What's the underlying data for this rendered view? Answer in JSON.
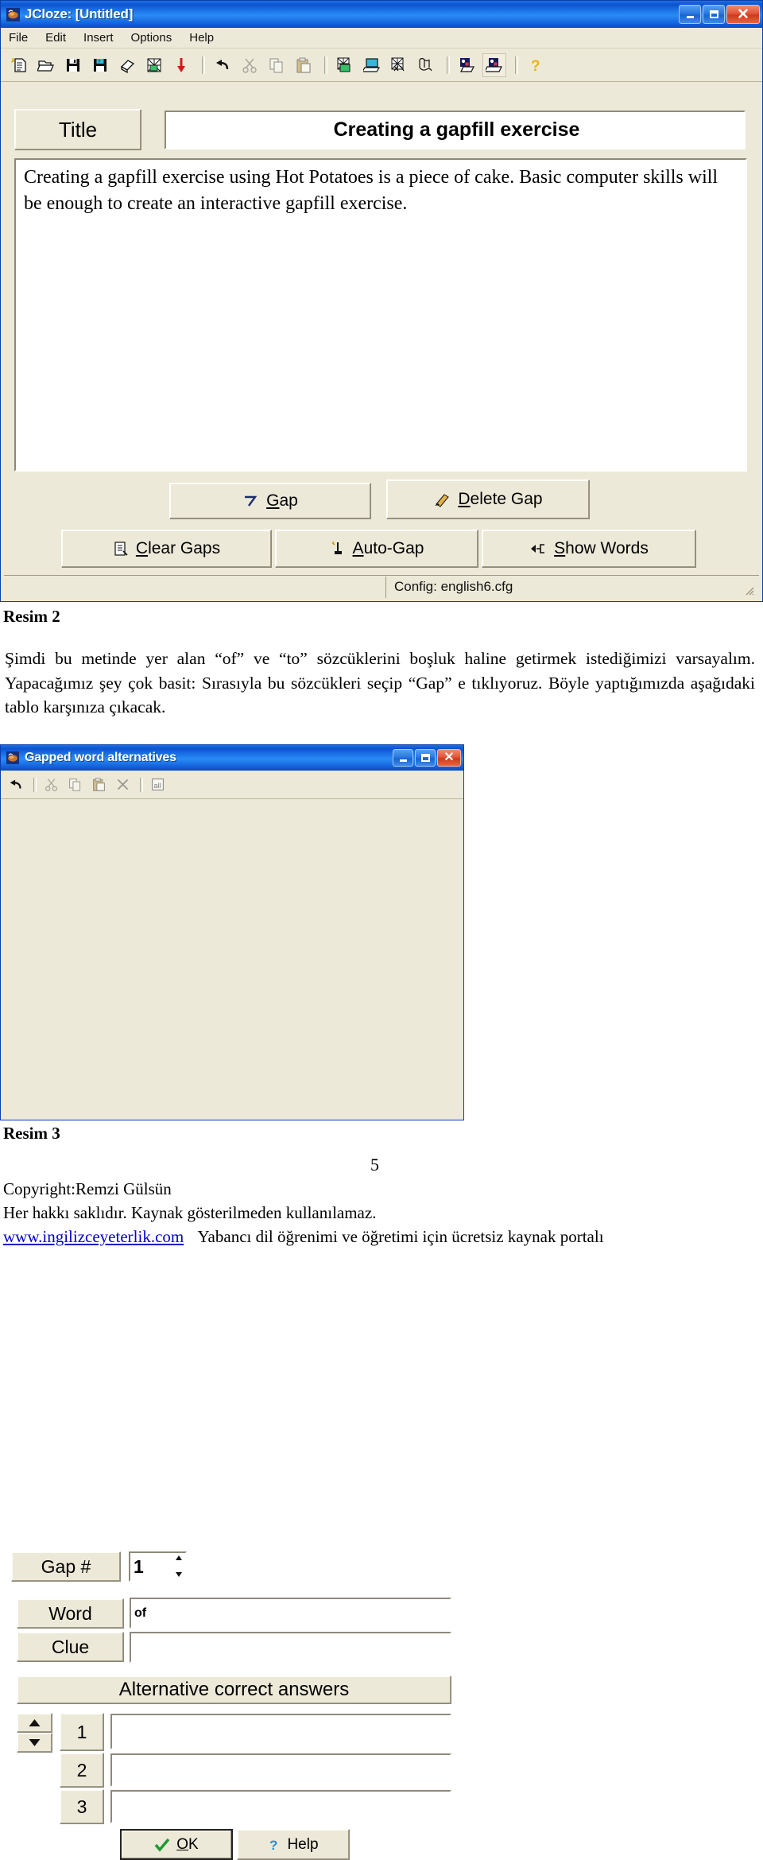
{
  "jcloze_window": {
    "title": "JCloze: [Untitled]",
    "app_icon": "hotpotato-icon",
    "window_buttons": [
      "minimize",
      "maximize",
      "close"
    ],
    "menu": [
      "File",
      "Edit",
      "Insert",
      "Options",
      "Help"
    ],
    "toolbar_icons": [
      "new-document-icon",
      "open-folder-icon",
      "save-icon",
      "save-as-icon",
      "eraser-icon",
      "scramble-icon",
      "red-down-arrow-icon",
      "undo-icon",
      "cut-icon",
      "copy-icon",
      "paste-icon",
      "export-webpage-icon",
      "export-drag-icon",
      "export-scramble-icon",
      "export-mixed-icon",
      "export-v6-icon",
      "export-v6-drag-icon",
      "help-question-icon"
    ],
    "title_label": "Title",
    "title_value": "Creating a gapfill exercise",
    "text_body": "Creating a gapfill exercise using Hot Potatoes is a piece of cake. Basic computer skills will be enough to create an interactive gapfill exercise.",
    "buttons": {
      "gap": "Gap",
      "delete_gap": "Delete Gap",
      "clear_gaps": "Clear Gaps",
      "auto_gap": "Auto-Gap",
      "show_words": "Show Words"
    },
    "status_bar": "Config: english6.cfg"
  },
  "caption_2": "Resim 2",
  "paragraph_tr": "Şimdi bu metinde yer alan “of” ve “to” sözcüklerini boşluk haline getirmek istediğimizi varsayalım. Yapacağımız şey çok basit: Sırasıyla bu sözcükleri seçip “Gap” e tıklıyoruz. Böyle yaptığımızda aşağıdaki tablo karşınıza çıkacak.",
  "gapped_dialog": {
    "title": "Gapped word alternatives",
    "app_icon": "hotpotato-icon",
    "window_buttons": [
      "minimize",
      "maximize",
      "close"
    ],
    "toolbar_icons": [
      "undo-icon",
      "cut-icon",
      "copy-icon",
      "paste-icon",
      "delete-x-icon",
      "select-all-icon"
    ],
    "gap_number_label": "Gap #",
    "gap_number_value": "1",
    "word_label": "Word",
    "word_value": "of",
    "clue_label": "Clue",
    "clue_value": "",
    "alternatives_header": "Alternative correct answers",
    "alternatives": [
      {
        "number": "1",
        "value": ""
      },
      {
        "number": "2",
        "value": ""
      },
      {
        "number": "3",
        "value": ""
      }
    ],
    "ok_button": "OK",
    "help_button": "Help"
  },
  "caption_3": "Resim 3",
  "page_number": "5",
  "footer": {
    "copyright": "Copyright:Remzi Gülsün",
    "rights": "Her hakkı saklıdır. Kaynak gösterilmeden kullanılamaz.",
    "site": "www.ingilizceyeterlik.com",
    "tagline": "Yabancı dil öğrenimi ve öğretimi için ücretsiz kaynak portalı"
  },
  "colors": {
    "titlebar_blue": "#1a6ee4",
    "face": "#ece9d8",
    "close_red": "#cf3a1c",
    "link_blue": "#0000cc"
  }
}
